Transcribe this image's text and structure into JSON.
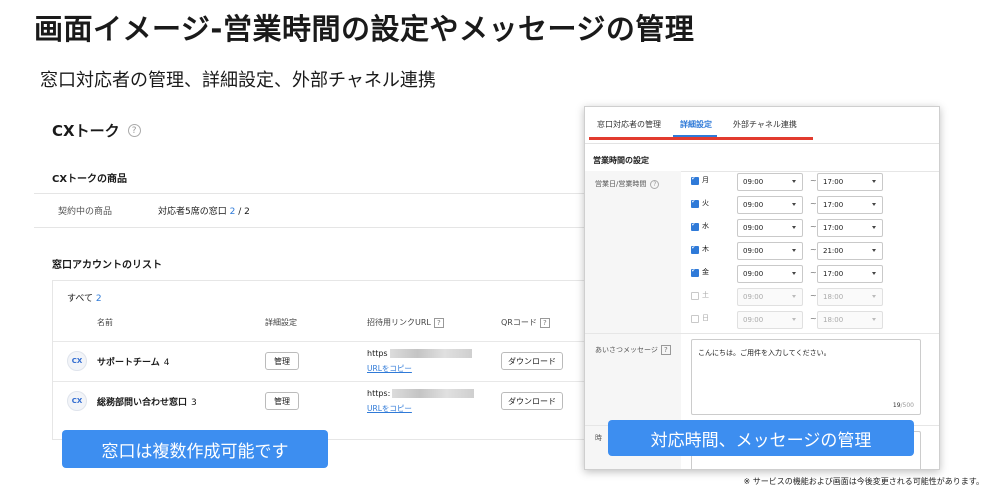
{
  "slide": {
    "title": "画面イメージ-営業時間の設定やメッセージの管理",
    "subtitle": "窓口対応者の管理、詳細設定、外部チャネル連携",
    "footnote": "※ サービスの機能および画面は今後変更される可能性があります。"
  },
  "left_screen": {
    "title": "CXトーク",
    "help_icon": "?",
    "product_section_title": "CXトークの商品",
    "product_label": "契約中の商品",
    "product_value_prefix": "対応者5席の窓口",
    "product_used": "2",
    "product_sep": " / ",
    "product_total": "2",
    "list_title": "窓口アカウントのリスト",
    "all_label": "すべて",
    "all_count": "2",
    "columns": {
      "name": "名前",
      "settings": "詳細設定",
      "invite_url": "招待用リンクURL",
      "qr": "QRコード"
    },
    "accounts": [
      {
        "name": "サポートチーム",
        "count": "4",
        "manage_label": "管理",
        "url_prefix": "https",
        "copy_label": "URLをコピー",
        "download_label": "ダウンロード",
        "avatar_text": "CX"
      },
      {
        "name": "総務部問い合わせ窓口",
        "count": "3",
        "manage_label": "管理",
        "url_prefix": "https:",
        "copy_label": "URLをコピー",
        "download_label": "ダウンロード",
        "avatar_text": "CX"
      }
    ],
    "callout": "窓口は複数作成可能です"
  },
  "panel": {
    "tabs": [
      "窓口対応者の管理",
      "詳細設定",
      "外部チャネル連携"
    ],
    "active_tab": 1,
    "section_title": "営業時間の設定",
    "business_days_label": "営業日/営業時間",
    "days": [
      {
        "label": "月",
        "checked": true,
        "start": "09:00",
        "end": "17:00"
      },
      {
        "label": "火",
        "checked": true,
        "start": "09:00",
        "end": "17:00"
      },
      {
        "label": "水",
        "checked": true,
        "start": "09:00",
        "end": "17:00"
      },
      {
        "label": "木",
        "checked": true,
        "start": "09:00",
        "end": "21:00"
      },
      {
        "label": "金",
        "checked": true,
        "start": "09:00",
        "end": "17:00"
      },
      {
        "label": "土",
        "checked": false,
        "start": "09:00",
        "end": "18:00"
      },
      {
        "label": "日",
        "checked": false,
        "start": "09:00",
        "end": "18:00"
      }
    ],
    "range_separator": "~",
    "greeting_label": "あいさつメッセージ",
    "greeting_text": "こんにちは。ご用件を入力してください。",
    "greeting_count": "19",
    "greeting_max": "/500",
    "lower_label_cut": "時",
    "callout": "対応時間、メッセージの管理"
  },
  "colors": {
    "accent": "#2f7ad8",
    "callout": "#3d8ef0",
    "tab_highlight": "#e23b2e"
  }
}
